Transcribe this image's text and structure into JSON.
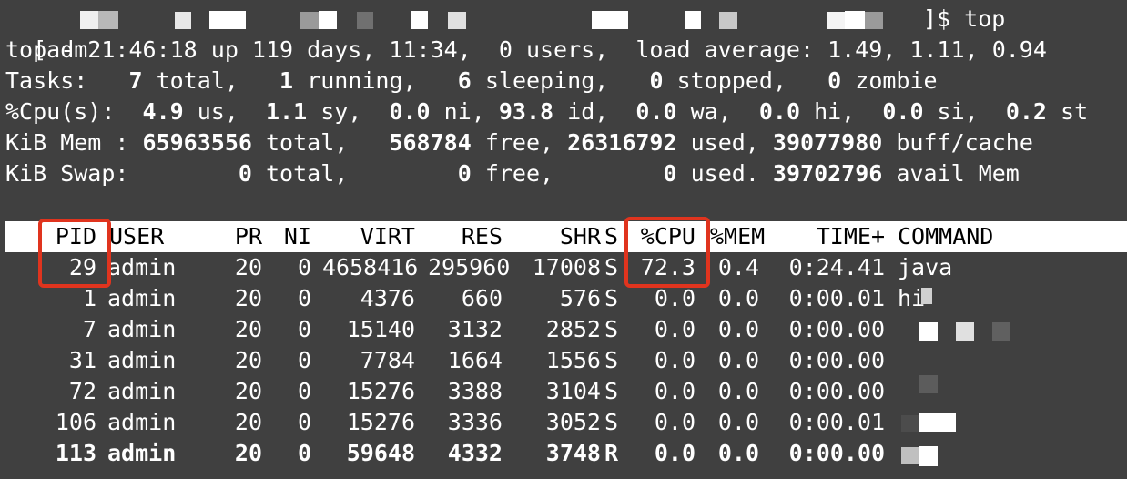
{
  "prompt_line": {
    "user_fragment": "[adm",
    "command": "]$ top"
  },
  "summary": {
    "l1": "top - 21:46:18 up 119 days, 11:34,  0 users,  load average: 1.49, 1.11, 0.94",
    "tasks": [
      {
        "t": "Tasks:   ",
        "b": false
      },
      {
        "t": "7",
        "b": true
      },
      {
        "t": " total,   ",
        "b": false
      },
      {
        "t": "1",
        "b": true
      },
      {
        "t": " running,   ",
        "b": false
      },
      {
        "t": "6",
        "b": true
      },
      {
        "t": " sleeping,   ",
        "b": false
      },
      {
        "t": "0",
        "b": true
      },
      {
        "t": " stopped,   ",
        "b": false
      },
      {
        "t": "0",
        "b": true
      },
      {
        "t": " zombie",
        "b": false
      }
    ],
    "cpu": [
      {
        "t": "%Cpu(s):  ",
        "b": false
      },
      {
        "t": "4.9",
        "b": true
      },
      {
        "t": " us,  ",
        "b": false
      },
      {
        "t": "1.1",
        "b": true
      },
      {
        "t": " sy,  ",
        "b": false
      },
      {
        "t": "0.0",
        "b": true
      },
      {
        "t": " ni, ",
        "b": false
      },
      {
        "t": "93.8",
        "b": true
      },
      {
        "t": " id,  ",
        "b": false
      },
      {
        "t": "0.0",
        "b": true
      },
      {
        "t": " wa,  ",
        "b": false
      },
      {
        "t": "0.0",
        "b": true
      },
      {
        "t": " hi,  ",
        "b": false
      },
      {
        "t": "0.0",
        "b": true
      },
      {
        "t": " si,  ",
        "b": false
      },
      {
        "t": "0.2",
        "b": true
      },
      {
        "t": " st",
        "b": false
      }
    ],
    "mem": [
      {
        "t": "KiB Mem : ",
        "b": false
      },
      {
        "t": "65963556",
        "b": true
      },
      {
        "t": " total,   ",
        "b": false
      },
      {
        "t": "568784",
        "b": true
      },
      {
        "t": " free, ",
        "b": false
      },
      {
        "t": "26316792",
        "b": true
      },
      {
        "t": " used, ",
        "b": false
      },
      {
        "t": "39077980",
        "b": true
      },
      {
        "t": " buff/cache",
        "b": false
      }
    ],
    "swap": [
      {
        "t": "KiB Swap:        ",
        "b": false
      },
      {
        "t": "0",
        "b": true
      },
      {
        "t": " total,        ",
        "b": false
      },
      {
        "t": "0",
        "b": true
      },
      {
        "t": " free,        ",
        "b": false
      },
      {
        "t": "0",
        "b": true
      },
      {
        "t": " used. ",
        "b": false
      },
      {
        "t": "39702796",
        "b": true
      },
      {
        "t": " avail Mem",
        "b": false
      }
    ]
  },
  "table": {
    "headers": [
      "PID",
      "USER",
      "PR",
      "NI",
      "VIRT",
      "RES",
      "SHR",
      "S",
      "%CPU",
      "%MEM",
      "TIME+",
      "COMMAND"
    ],
    "rows": [
      {
        "pid": "29",
        "user": "admin",
        "pr": "20",
        "ni": "0",
        "virt": "4658416",
        "res": "295960",
        "shr": "17008",
        "s": "S",
        "cpu": "72.3",
        "mem": "0.4",
        "time": "0:24.41",
        "command": "java",
        "bold": false
      },
      {
        "pid": "1",
        "user": "admin",
        "pr": "20",
        "ni": "0",
        "virt": "4376",
        "res": "660",
        "shr": "576",
        "s": "S",
        "cpu": "0.0",
        "mem": "0.0",
        "time": "0:00.01",
        "command": "hi",
        "bold": false
      },
      {
        "pid": "7",
        "user": "admin",
        "pr": "20",
        "ni": "0",
        "virt": "15140",
        "res": "3132",
        "shr": "2852",
        "s": "S",
        "cpu": "0.0",
        "mem": "0.0",
        "time": "0:00.00",
        "command": "",
        "bold": false
      },
      {
        "pid": "31",
        "user": "admin",
        "pr": "20",
        "ni": "0",
        "virt": "7784",
        "res": "1664",
        "shr": "1556",
        "s": "S",
        "cpu": "0.0",
        "mem": "0.0",
        "time": "0:00.00",
        "command": "",
        "bold": false
      },
      {
        "pid": "72",
        "user": "admin",
        "pr": "20",
        "ni": "0",
        "virt": "15276",
        "res": "3388",
        "shr": "3104",
        "s": "S",
        "cpu": "0.0",
        "mem": "0.0",
        "time": "0:00.00",
        "command": "",
        "bold": false
      },
      {
        "pid": "106",
        "user": "admin",
        "pr": "20",
        "ni": "0",
        "virt": "15276",
        "res": "3336",
        "shr": "3052",
        "s": "S",
        "cpu": "0.0",
        "mem": "0.0",
        "time": "0:00.01",
        "command": "",
        "bold": false
      },
      {
        "pid": "113",
        "user": "admin",
        "pr": "20",
        "ni": "0",
        "virt": "59648",
        "res": "4332",
        "shr": "3748",
        "s": "R",
        "cpu": "0.0",
        "mem": "0.0",
        "time": "0:00.00",
        "command": "",
        "bold": true
      }
    ]
  },
  "colors": {
    "background": "#404040",
    "foreground": "#ffffff",
    "header_bar": "#ffffff",
    "highlight_box": "#e0341e"
  }
}
